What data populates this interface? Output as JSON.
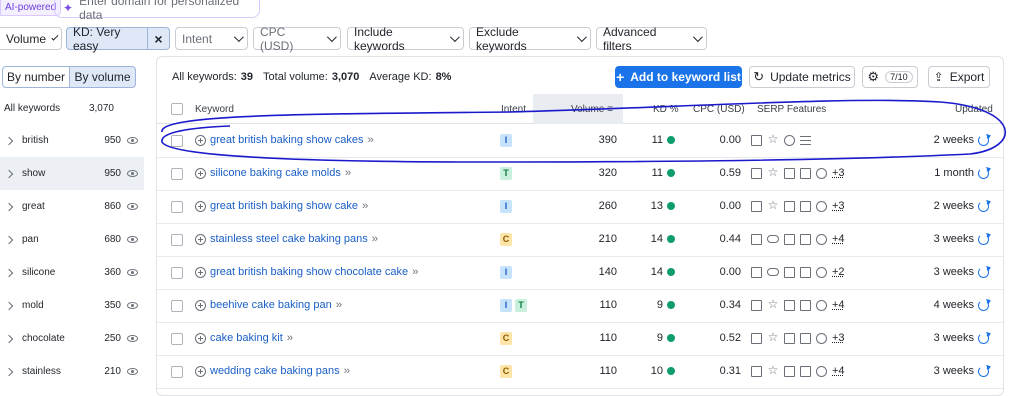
{
  "ai": {
    "badge": "AI-powered",
    "placeholder": "Enter domain for personalized data"
  },
  "filters": {
    "volume": "Volume",
    "kd": "KD: Very easy",
    "intent": "Intent",
    "cpc": "CPC (USD)",
    "include": "Include keywords",
    "exclude": "Exclude keywords",
    "advanced": "Advanced filters"
  },
  "left": {
    "by_number": "By number",
    "by_volume": "By volume",
    "all_label": "All keywords",
    "all_count": "3,070",
    "groups": [
      {
        "word": "british",
        "count": "950"
      },
      {
        "word": "show",
        "count": "950"
      },
      {
        "word": "great",
        "count": "860"
      },
      {
        "word": "pan",
        "count": "680"
      },
      {
        "word": "silicone",
        "count": "360"
      },
      {
        "word": "mold",
        "count": "350"
      },
      {
        "word": "chocolate",
        "count": "250"
      },
      {
        "word": "stainless",
        "count": "210"
      }
    ]
  },
  "summary": {
    "all_label": "All keywords:",
    "all_value": "39",
    "vol_label": "Total volume:",
    "vol_value": "3,070",
    "kd_label": "Average KD:",
    "kd_value": "8%"
  },
  "toolbar": {
    "add_label": "Add to keyword list",
    "update_label": "Update metrics",
    "settings_badge": "7/10",
    "export_label": "Export"
  },
  "table": {
    "headers": {
      "keyword": "Keyword",
      "intent": "Intent",
      "volume": "Volume",
      "kd": "KD %",
      "cpc": "CPC (USD)",
      "serp": "SERP Features",
      "updated": "Updated"
    },
    "rows": [
      {
        "keyword": "great british baking show cakes",
        "intent": [
          "I"
        ],
        "volume": "390",
        "kd": "11",
        "cpc": "0.00",
        "serp_icons": [
          "image-icon",
          "star-icon",
          "video-icon",
          "list-icon"
        ],
        "serp_more": "",
        "updated": "2 weeks"
      },
      {
        "keyword": "silicone baking cake molds",
        "intent": [
          "T"
        ],
        "volume": "320",
        "kd": "11",
        "cpc": "0.59",
        "serp_icons": [
          "image-icon",
          "star-icon",
          "picture-icon",
          "carousel-icon",
          "video-icon"
        ],
        "serp_more": "+3",
        "updated": "1 month"
      },
      {
        "keyword": "great british baking show cake",
        "intent": [
          "I"
        ],
        "volume": "260",
        "kd": "13",
        "cpc": "0.00",
        "serp_icons": [
          "image-icon",
          "star-icon",
          "picture-icon",
          "carousel-icon",
          "video-icon"
        ],
        "serp_more": "+3",
        "updated": "2 weeks"
      },
      {
        "keyword": "stainless steel cake baking pans",
        "intent": [
          "C"
        ],
        "volume": "210",
        "kd": "14",
        "cpc": "0.44",
        "serp_icons": [
          "image-icon",
          "link-icon",
          "picture-icon",
          "carousel-icon",
          "video-icon"
        ],
        "serp_more": "+4",
        "updated": "3 weeks"
      },
      {
        "keyword": "great british baking show chocolate cake",
        "intent": [
          "I"
        ],
        "volume": "140",
        "kd": "14",
        "cpc": "0.00",
        "serp_icons": [
          "image-icon",
          "link-icon",
          "picture-icon",
          "carousel-icon",
          "video-icon"
        ],
        "serp_more": "+2",
        "updated": "3 weeks"
      },
      {
        "keyword": "beehive cake baking pan",
        "intent": [
          "I",
          "T"
        ],
        "volume": "110",
        "kd": "9",
        "cpc": "0.34",
        "serp_icons": [
          "image-icon",
          "star-icon",
          "picture-icon",
          "carousel-icon",
          "video-icon"
        ],
        "serp_more": "+4",
        "updated": "4 weeks"
      },
      {
        "keyword": "cake baking kit",
        "intent": [
          "C"
        ],
        "volume": "110",
        "kd": "9",
        "cpc": "0.52",
        "serp_icons": [
          "image-icon",
          "star-icon",
          "picture-icon",
          "carousel-icon",
          "video-icon"
        ],
        "serp_more": "+3",
        "updated": "3 weeks"
      },
      {
        "keyword": "wedding cake baking pans",
        "intent": [
          "C"
        ],
        "volume": "110",
        "kd": "10",
        "cpc": "0.31",
        "serp_icons": [
          "image-icon",
          "star-icon",
          "picture-icon",
          "carousel-icon",
          "video-icon"
        ],
        "serp_more": "+4",
        "updated": "3 weeks"
      }
    ]
  },
  "colors": {
    "accent": "#1a73e8",
    "kd_easy": "#0f9d6b",
    "annotation": "#1a1acc"
  }
}
